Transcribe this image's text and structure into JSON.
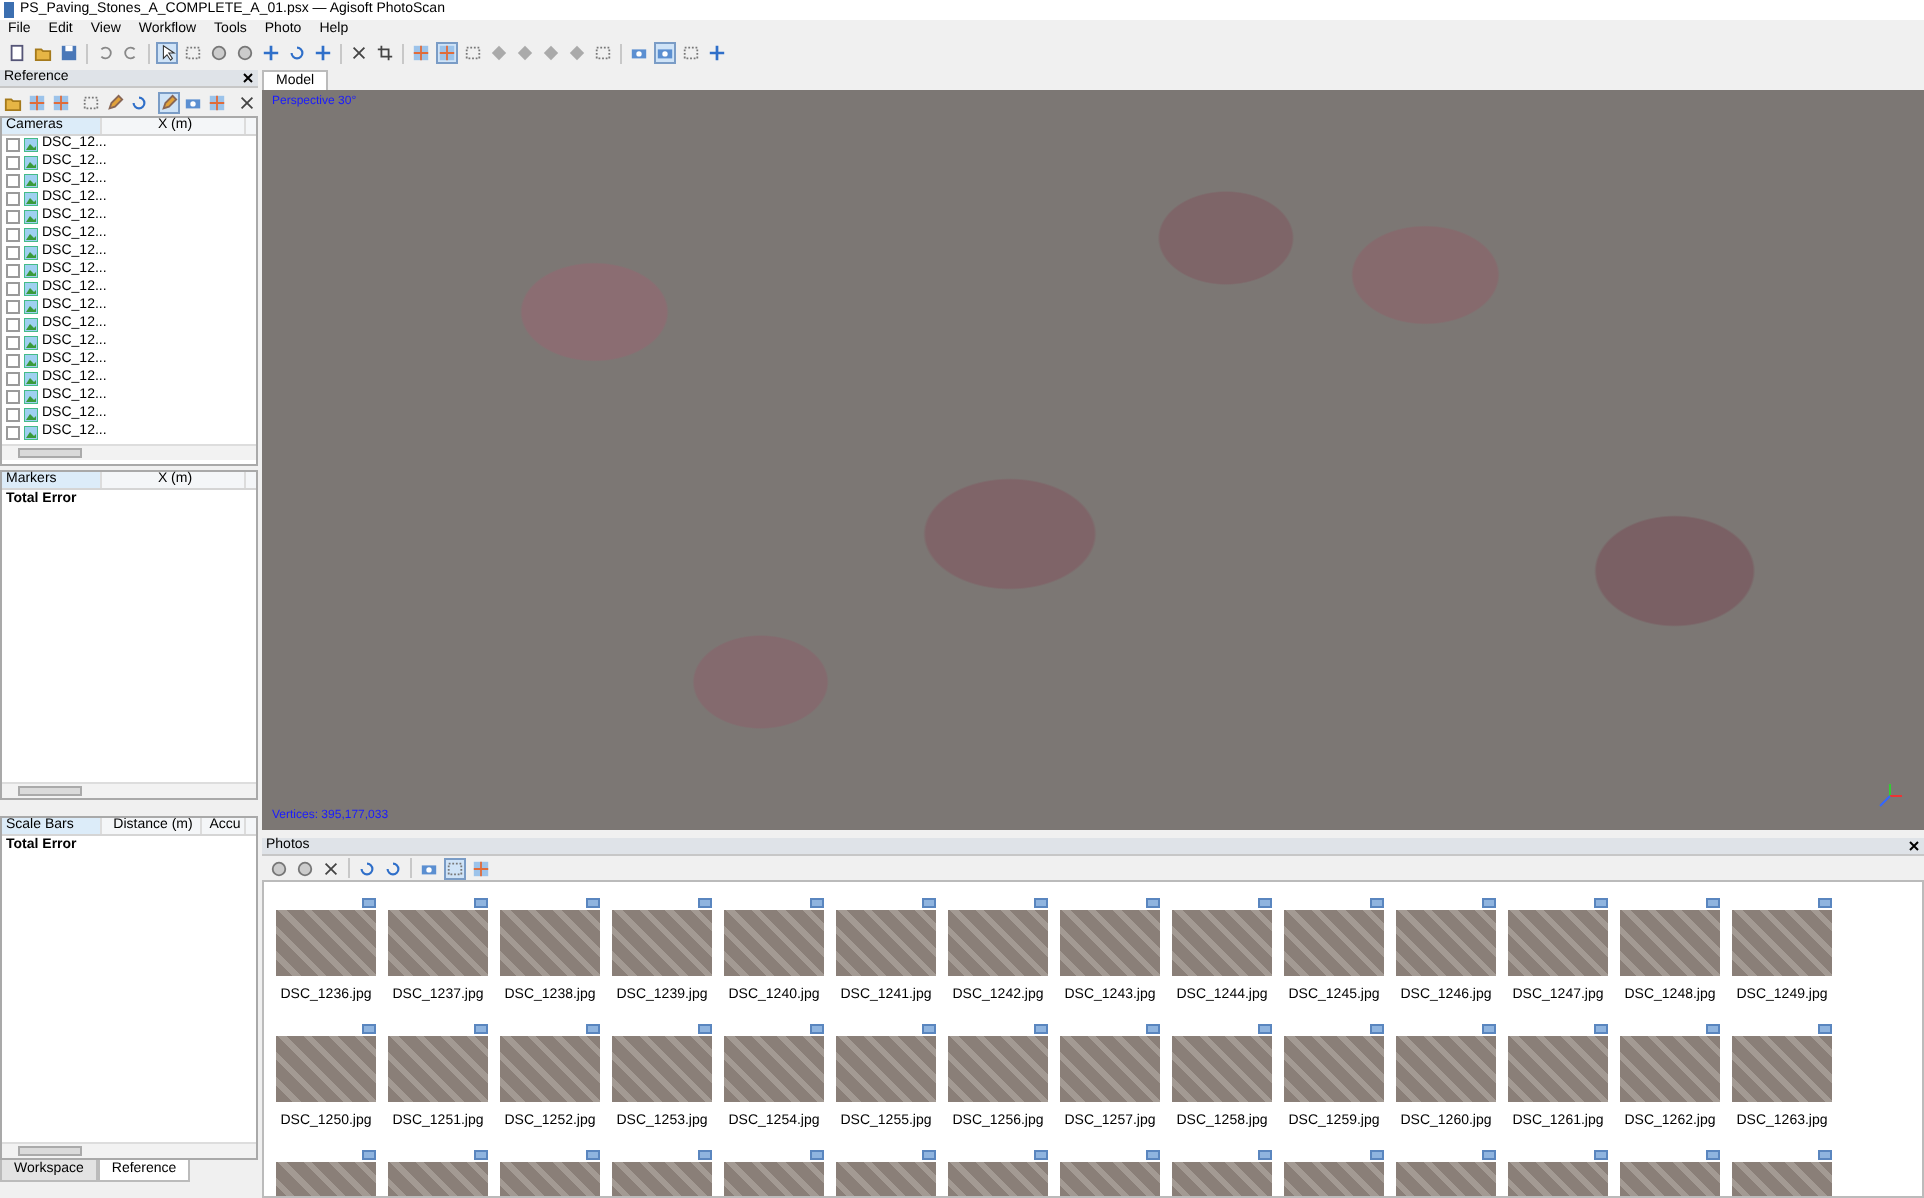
{
  "window": {
    "title": "PS_Paving_Stones_A_COMPLETE_A_01.psx — Agisoft PhotoScan"
  },
  "menu": [
    "File",
    "Edit",
    "View",
    "Workflow",
    "Tools",
    "Photo",
    "Help"
  ],
  "main_toolbar": [
    {
      "kind": "new",
      "pressed": false
    },
    {
      "kind": "open",
      "pressed": false
    },
    {
      "kind": "save",
      "pressed": false
    },
    {
      "kind": "sep"
    },
    {
      "kind": "undo",
      "pressed": false
    },
    {
      "kind": "redo",
      "pressed": false
    },
    {
      "kind": "sep"
    },
    {
      "kind": "pointer",
      "pressed": true
    },
    {
      "kind": "rect",
      "pressed": false
    },
    {
      "kind": "circle",
      "pressed": false
    },
    {
      "kind": "circle",
      "pressed": false
    },
    {
      "kind": "move",
      "pressed": false
    },
    {
      "kind": "rotate",
      "pressed": false
    },
    {
      "kind": "move",
      "pressed": false
    },
    {
      "kind": "sep"
    },
    {
      "kind": "cross",
      "pressed": false
    },
    {
      "kind": "crop",
      "pressed": false
    },
    {
      "kind": "sep"
    },
    {
      "kind": "grid",
      "pressed": false
    },
    {
      "kind": "grid",
      "pressed": true
    },
    {
      "kind": "rect",
      "pressed": false
    },
    {
      "kind": "diamond",
      "pressed": false
    },
    {
      "kind": "diamond",
      "pressed": false
    },
    {
      "kind": "diamond",
      "pressed": false
    },
    {
      "kind": "diamond",
      "pressed": false
    },
    {
      "kind": "rect",
      "pressed": false
    },
    {
      "kind": "sep"
    },
    {
      "kind": "camera",
      "pressed": false
    },
    {
      "kind": "camera",
      "pressed": true
    },
    {
      "kind": "rect",
      "pressed": false
    },
    {
      "kind": "move",
      "pressed": false
    }
  ],
  "reference_panel": {
    "title": "Reference",
    "toolbar": [
      {
        "kind": "open",
        "pressed": false
      },
      {
        "kind": "grid",
        "pressed": false
      },
      {
        "kind": "grid",
        "pressed": false
      },
      {
        "kind": "sep"
      },
      {
        "kind": "rect",
        "pressed": false
      },
      {
        "kind": "pencil",
        "pressed": false
      },
      {
        "kind": "rotate",
        "pressed": false
      },
      {
        "kind": "sep"
      },
      {
        "kind": "pencil",
        "pressed": true
      },
      {
        "kind": "camera",
        "pressed": false
      },
      {
        "kind": "grid",
        "pressed": false
      },
      {
        "kind": "sep"
      },
      {
        "kind": "cross",
        "pressed": false
      }
    ],
    "cameras": {
      "columns": [
        "Cameras",
        "X (m)"
      ],
      "rows": [
        {
          "label": "DSC_12...",
          "checked": false
        },
        {
          "label": "DSC_12...",
          "checked": false
        },
        {
          "label": "DSC_12...",
          "checked": false
        },
        {
          "label": "DSC_12...",
          "checked": false
        },
        {
          "label": "DSC_12...",
          "checked": false
        },
        {
          "label": "DSC_12...",
          "checked": false
        },
        {
          "label": "DSC_12...",
          "checked": false
        },
        {
          "label": "DSC_12...",
          "checked": false
        },
        {
          "label": "DSC_12...",
          "checked": false
        },
        {
          "label": "DSC_12...",
          "checked": false
        },
        {
          "label": "DSC_12...",
          "checked": false
        },
        {
          "label": "DSC_12...",
          "checked": false
        },
        {
          "label": "DSC_12...",
          "checked": false
        },
        {
          "label": "DSC_12...",
          "checked": false
        },
        {
          "label": "DSC_12...",
          "checked": false
        },
        {
          "label": "DSC_12...",
          "checked": false
        },
        {
          "label": "DSC_12...",
          "checked": false
        }
      ]
    },
    "markers": {
      "columns": [
        "Markers",
        "X (m)"
      ],
      "total": "Total Error"
    },
    "scale_bars": {
      "columns": [
        "Scale Bars",
        "Distance (m)",
        "Accu"
      ],
      "total": "Total Error"
    }
  },
  "bottom_tabs": [
    {
      "label": "Workspace",
      "selected": false
    },
    {
      "label": "Reference",
      "selected": true
    }
  ],
  "model_view": {
    "tab": "Model",
    "projection": "Perspective 30°",
    "vertices": "Vertices: 395,177,033"
  },
  "photos_panel": {
    "title": "Photos",
    "toolbar": [
      {
        "kind": "circle",
        "pressed": false
      },
      {
        "kind": "circle",
        "pressed": false
      },
      {
        "kind": "cross",
        "pressed": false
      },
      {
        "kind": "sep"
      },
      {
        "kind": "rotate",
        "pressed": false
      },
      {
        "kind": "rotate",
        "pressed": false
      },
      {
        "kind": "sep"
      },
      {
        "kind": "camera",
        "pressed": false
      },
      {
        "kind": "rect",
        "pressed": true
      },
      {
        "kind": "grid",
        "pressed": false
      }
    ],
    "photos": [
      "DSC_1236.jpg",
      "DSC_1237.jpg",
      "DSC_1238.jpg",
      "DSC_1239.jpg",
      "DSC_1240.jpg",
      "DSC_1241.jpg",
      "DSC_1242.jpg",
      "DSC_1243.jpg",
      "DSC_1244.jpg",
      "DSC_1245.jpg",
      "DSC_1246.jpg",
      "DSC_1247.jpg",
      "DSC_1248.jpg",
      "DSC_1249.jpg",
      "DSC_1250.jpg",
      "DSC_1251.jpg",
      "DSC_1252.jpg",
      "DSC_1253.jpg",
      "DSC_1254.jpg",
      "DSC_1255.jpg",
      "DSC_1256.jpg",
      "DSC_1257.jpg",
      "DSC_1258.jpg",
      "DSC_1259.jpg",
      "DSC_1260.jpg",
      "DSC_1261.jpg",
      "DSC_1262.jpg",
      "DSC_1263.jpg"
    ]
  }
}
